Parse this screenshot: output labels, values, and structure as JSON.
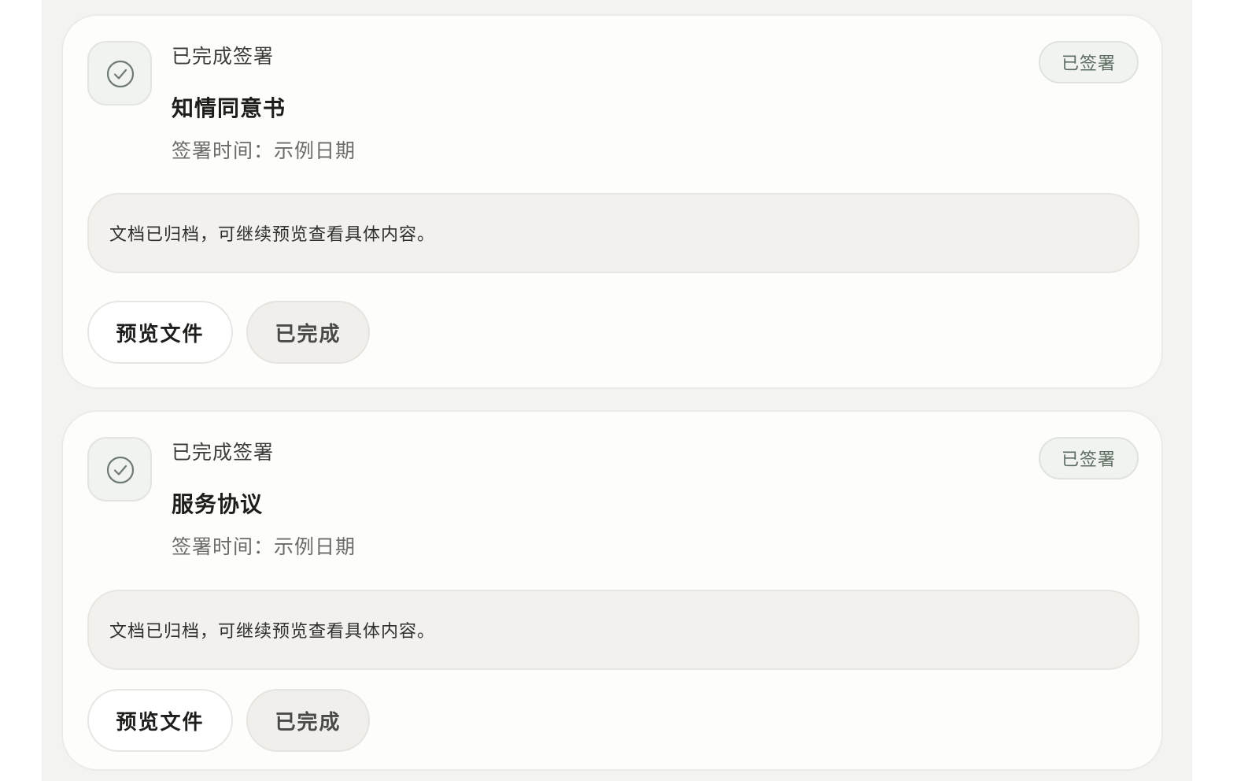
{
  "cards": [
    {
      "status_label": "已完成签署",
      "title": "知情同意书",
      "sign_time": "签署时间：示例日期",
      "badge": "已签署",
      "note": "文档已归档，可继续预览查看具体内容。",
      "preview_label": "预览文件",
      "done_label": "已完成",
      "icon": "check-circle-icon"
    },
    {
      "status_label": "已完成签署",
      "title": "服务协议",
      "sign_time": "签署时间：示例日期",
      "badge": "已签署",
      "note": "文档已归档，可继续预览查看具体内容。",
      "preview_label": "预览文件",
      "done_label": "已完成",
      "icon": "check-circle-icon"
    }
  ],
  "colors": {
    "page_background": "#f3f3f2",
    "card_background": "#fdfdfc",
    "check_icon": "#6f7a72",
    "badge_text": "#5c6c60"
  }
}
